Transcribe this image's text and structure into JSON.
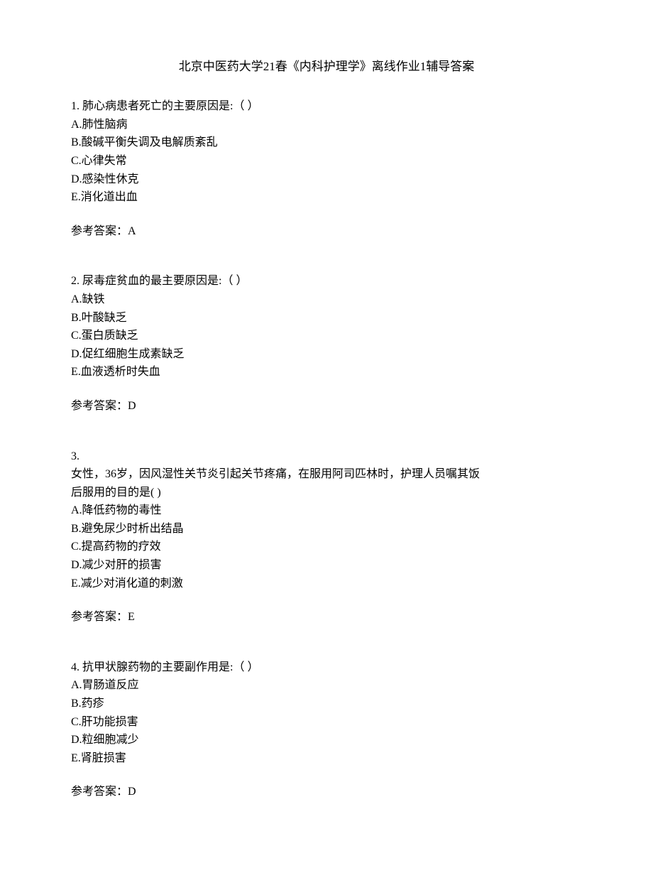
{
  "title": "北京中医药大学21春《内科护理学》离线作业1辅导答案",
  "questions": [
    {
      "number": "1.",
      "stem": "肺心病患者死亡的主要原因是:（  ）",
      "options": [
        "A.肺性脑病",
        "B.酸碱平衡失调及电解质紊乱",
        "C.心律失常",
        "D.感染性休克",
        "E.消化道出血"
      ],
      "answer_label": "参考答案：",
      "answer_value": "A"
    },
    {
      "number": "2.",
      "stem": "尿毒症贫血的最主要原因是:（  ）",
      "options": [
        "A.缺铁",
        "B.叶酸缺乏",
        "C.蛋白质缺乏",
        "D.促红细胞生成素缺乏",
        "E.血液透析时失血"
      ],
      "answer_label": "参考答案：",
      "answer_value": "D"
    },
    {
      "number": "3.",
      "stem_line1": "女性，36岁，因风湿性关节炎引起关节疼痛，在服用阿司匹林时，护理人员嘱其饭",
      "stem_line2": "后服用的目的是(  )",
      "options": [
        "A.降低药物的毒性",
        "B.避免尿少时析出结晶",
        "C.提高药物的疗效",
        "D.减少对肝的损害",
        "E.减少对消化道的刺激"
      ],
      "answer_label": "参考答案：",
      "answer_value": "E"
    },
    {
      "number": "4.",
      "stem": "抗甲状腺药物的主要副作用是:（  ）",
      "options": [
        "A.胃肠道反应",
        "B.药疹",
        "C.肝功能损害",
        "D.粒细胞减少",
        "E.肾脏损害"
      ],
      "answer_label": "参考答案：",
      "answer_value": "D"
    }
  ]
}
